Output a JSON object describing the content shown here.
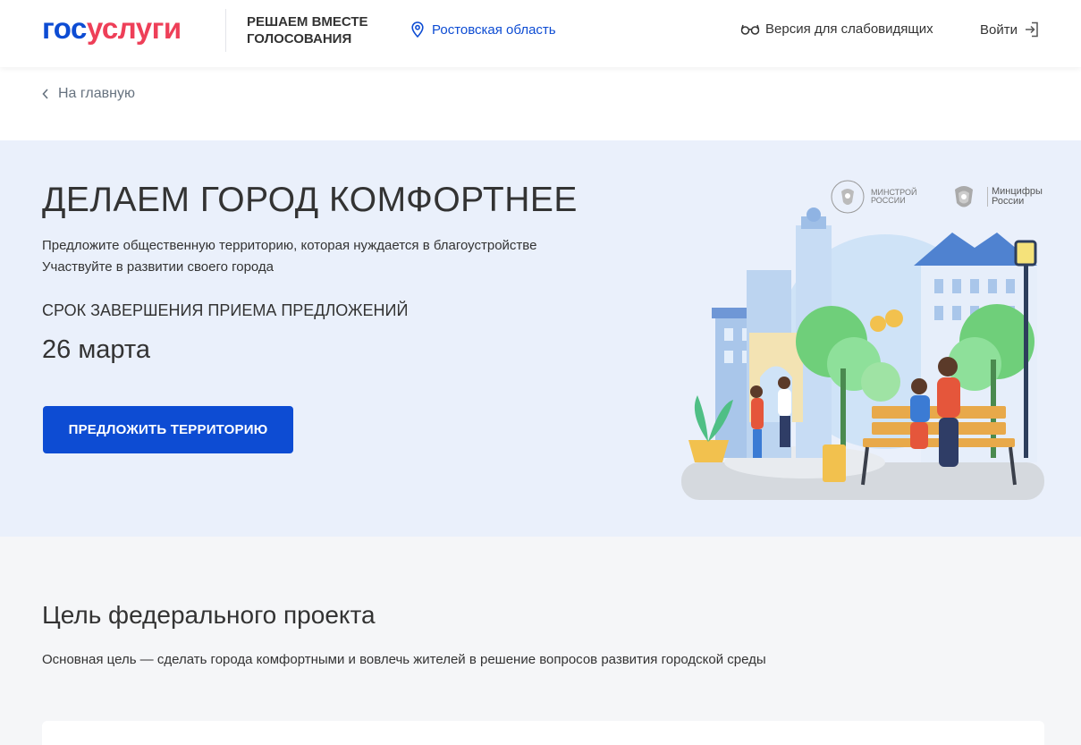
{
  "header": {
    "logo_part1": "гос",
    "logo_part2": "услуги",
    "slogan_line1": "РЕШАЕМ ВМЕСТЕ",
    "slogan_line2": "ГОЛОСОВАНИЯ",
    "region": "Ростовская область",
    "accessibility": "Версия для слабовидящих",
    "login": "Войти"
  },
  "breadcrumb": {
    "back": "На главную"
  },
  "hero": {
    "title": "ДЕЛАЕМ ГОРОД КОМФОРТНЕЕ",
    "subtitle_line1": "Предложите общественную территорию, которая нуждается в благоустройстве",
    "subtitle_line2": "Участвуйте в развитии своего города",
    "deadline_label": "СРОК ЗАВЕРШЕНИЯ ПРИЕМА ПРЕДЛОЖЕНИЙ",
    "deadline_date": "26 марта",
    "cta": "ПРЕДЛОЖИТЬ ТЕРРИТОРИЮ",
    "ministry1_line1": "МИНСТРОЙ",
    "ministry1_line2": "РОССИИ",
    "ministry2_line1": "Минцифры",
    "ministry2_line2": "России"
  },
  "goal": {
    "title": "Цель федерального проекта",
    "text": "Основная цель — сделать города комфортными и вовлечь жителей в решение вопросов развития городской среды"
  },
  "colors": {
    "brand_blue": "#0d4cd3",
    "brand_red": "#ee3f58",
    "hero_bg": "#eaf0fb"
  }
}
